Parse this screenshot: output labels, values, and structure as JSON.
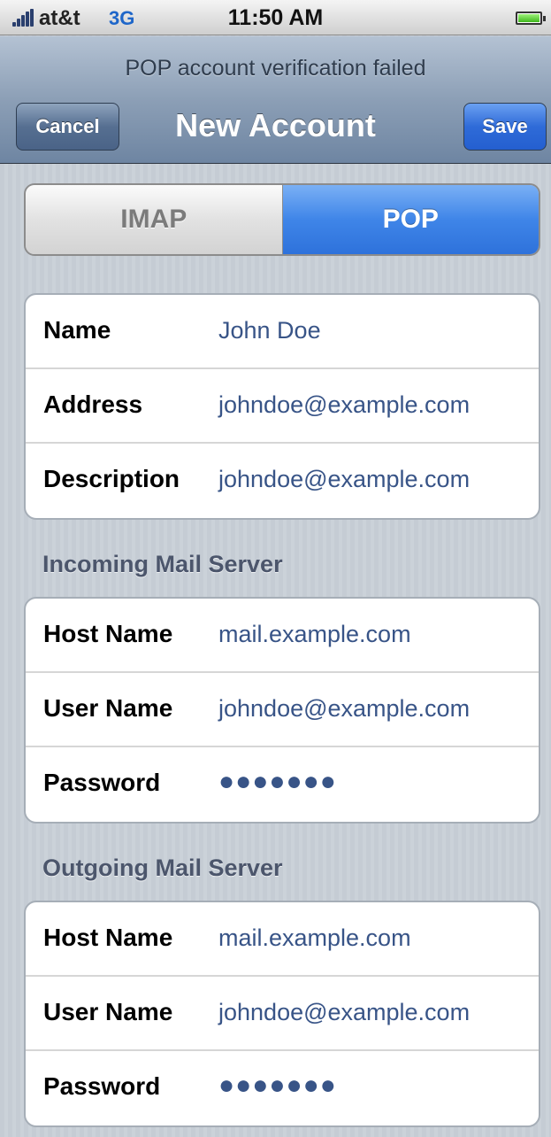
{
  "status_bar": {
    "carrier": "at&t",
    "network": "3G",
    "time": "11:50 AM"
  },
  "nav": {
    "prompt": "POP account verification failed",
    "title": "New Account",
    "cancel_label": "Cancel",
    "save_label": "Save"
  },
  "segmented": {
    "imap": "IMAP",
    "pop": "POP",
    "selected": "POP"
  },
  "account": {
    "name_label": "Name",
    "name_value": "John Doe",
    "address_label": "Address",
    "address_value": "johndoe@example.com",
    "description_label": "Description",
    "description_value": "johndoe@example.com"
  },
  "incoming": {
    "header": "Incoming Mail Server",
    "host_label": "Host Name",
    "host_value": "mail.example.com",
    "user_label": "User Name",
    "user_value": "johndoe@example.com",
    "password_label": "Password",
    "password_value": "●●●●●●●"
  },
  "outgoing": {
    "header": "Outgoing Mail Server",
    "host_label": "Host Name",
    "host_value": "mail.example.com",
    "user_label": "User Name",
    "user_value": "johndoe@example.com",
    "password_label": "Password",
    "password_value": "●●●●●●●"
  },
  "icons": {
    "signal": "signal-strength-icon",
    "battery": "battery-icon"
  },
  "colors": {
    "accent_blue": "#2f6bd8",
    "value_text": "#385487",
    "section_header": "#4c566c"
  }
}
